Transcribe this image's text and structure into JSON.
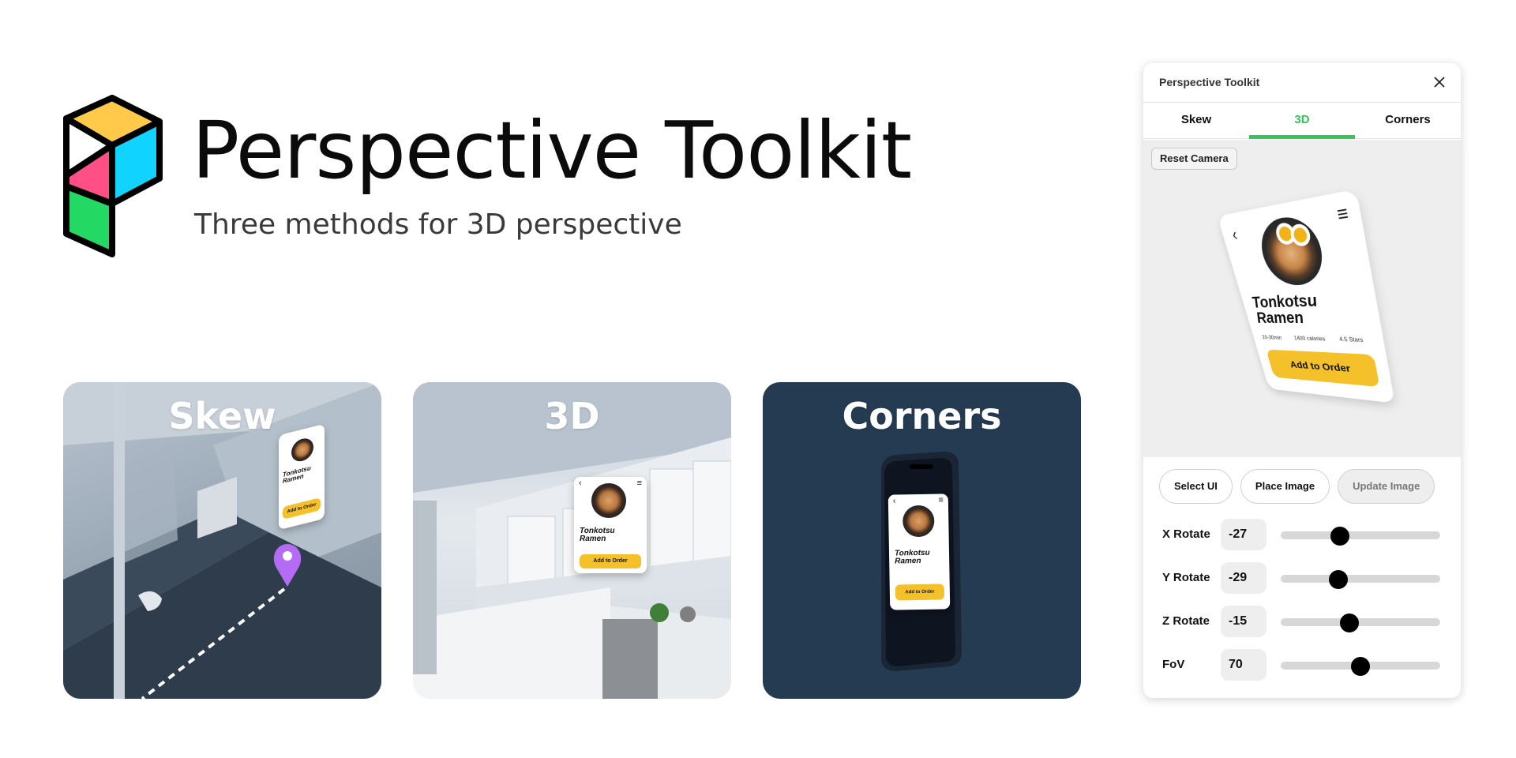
{
  "hero": {
    "title": "Perspective Toolkit",
    "subtitle": "Three methods for 3D perspective",
    "logo_colors": [
      "#ffc94a",
      "#10d4ff",
      "#ff4f86",
      "#24d864"
    ]
  },
  "cards": [
    {
      "id": "skew",
      "title": "Skew",
      "bg": "#9aa8b6"
    },
    {
      "id": "3d",
      "title": "3D",
      "bg": "#d7dde3"
    },
    {
      "id": "corners",
      "title": "Corners",
      "bg": "#253b52"
    }
  ],
  "mini_ui": {
    "name_line1": "Tonkotsu",
    "name_line2": "Ramen",
    "meta_time": "20-30min",
    "meta_cal": "1400 calories",
    "meta_stars": "4.5 Stars",
    "button": "Add to Order",
    "back_icon": "‹",
    "menu_icon": "≡"
  },
  "panel": {
    "title": "Perspective Toolkit",
    "close_icon": "close-icon",
    "tabs": [
      {
        "label": "Skew",
        "active": false
      },
      {
        "label": "3D",
        "active": true
      },
      {
        "label": "Corners",
        "active": false
      }
    ],
    "reset_button": "Reset Camera",
    "actions": [
      {
        "label": "Select UI",
        "disabled": false
      },
      {
        "label": "Place Image",
        "disabled": false
      },
      {
        "label": "Update Image",
        "disabled": true
      }
    ],
    "controls": [
      {
        "label": "X Rotate",
        "value": "-27",
        "fraction": 0.37
      },
      {
        "label": "Y Rotate",
        "value": "-29",
        "fraction": 0.36
      },
      {
        "label": "Z Rotate",
        "value": "-15",
        "fraction": 0.43
      },
      {
        "label": "FoV",
        "value": "70",
        "fraction": 0.5
      }
    ],
    "accent": "#33c75b"
  }
}
